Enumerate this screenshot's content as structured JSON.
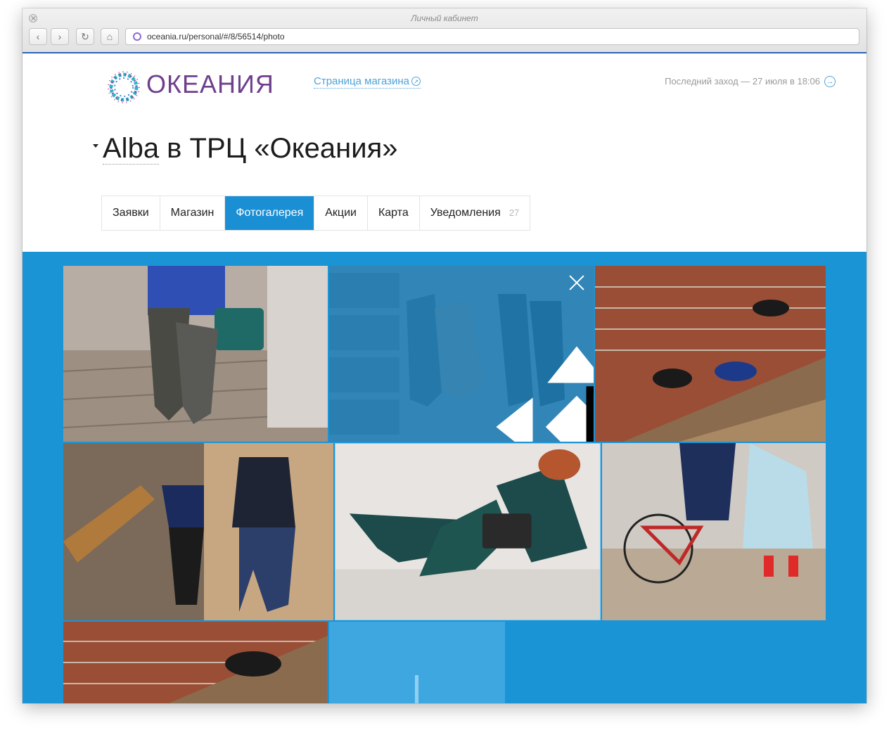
{
  "browser": {
    "window_title": "Личный кабинет",
    "url": "oceania.ru/personal/#/8/56514/photo",
    "back_glyph": "‹",
    "forward_glyph": "›",
    "reload_glyph": "↻",
    "home_glyph": "⌂"
  },
  "header": {
    "logo_text": "ОКЕАНИЯ",
    "store_page_link": "Страница магазина",
    "last_visit": "Последний заход — 27 июля в 18:06",
    "link_arrow_glyph": "↗",
    "visit_arrow_glyph": "→"
  },
  "store": {
    "name": "Alba",
    "title_rest": " в ТРЦ «Океания»"
  },
  "tabs": [
    {
      "label": "Заявки"
    },
    {
      "label": "Магазин"
    },
    {
      "label": "Фотогалерея",
      "active": true
    },
    {
      "label": "Акции"
    },
    {
      "label": "Карта"
    },
    {
      "label": "Уведомления",
      "badge": "27"
    }
  ],
  "gallery": {
    "photos": [
      {
        "name": "photo-boots-bench"
      },
      {
        "name": "photo-shoes-drawers",
        "state": "being-dragged"
      },
      {
        "name": "photo-shoes-brick-stairs"
      },
      {
        "name": "photo-couple-staircase"
      },
      {
        "name": "photo-green-boots"
      },
      {
        "name": "photo-bicycle-couple"
      },
      {
        "name": "photo-shoes-brick-stairs-2"
      }
    ],
    "icons": [
      "close-icon",
      "move-icon",
      "hand-cursor-icon"
    ]
  },
  "colors": {
    "accent": "#1b8fd4",
    "gallery_bg": "#1b94d6",
    "link": "#4fa3d8",
    "logo": "#6f3f8c",
    "url_bar_accent": "#2a62b7"
  }
}
